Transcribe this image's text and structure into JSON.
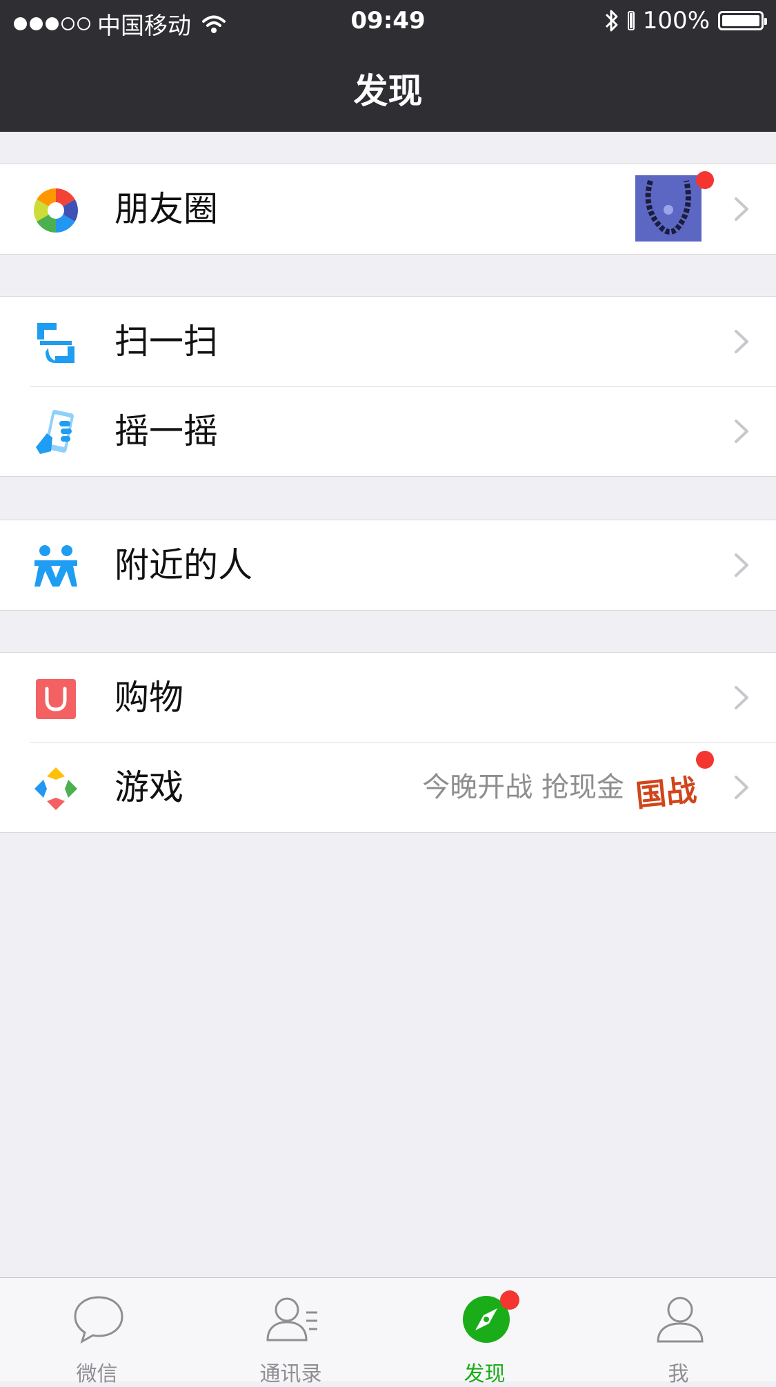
{
  "status_bar": {
    "carrier": "中国移动",
    "time": "09:49",
    "battery": "100%"
  },
  "nav": {
    "title": "发现"
  },
  "list": {
    "moments": {
      "label": "朋友圈"
    },
    "scan": {
      "label": "扫一扫"
    },
    "shake": {
      "label": "摇一摇"
    },
    "nearby": {
      "label": "附近的人"
    },
    "shopping": {
      "label": "购物"
    },
    "games": {
      "label": "游戏",
      "subtext": "今晚开战 抢现金",
      "badge_text": "国战"
    }
  },
  "tabs": [
    {
      "label": "微信"
    },
    {
      "label": "通讯录"
    },
    {
      "label": "发现"
    },
    {
      "label": "我"
    }
  ],
  "colors": {
    "accent": "#1aad19",
    "badge_red": "#f43530",
    "nav_bg": "#2e2e33",
    "page_bg": "#efeff4"
  },
  "icons": {
    "moments": "aperture-icon",
    "scan": "scan-icon",
    "shake": "shake-phone-icon",
    "nearby": "people-nearby-icon",
    "shopping": "shopping-bag-icon",
    "games": "game-diamond-icon"
  }
}
